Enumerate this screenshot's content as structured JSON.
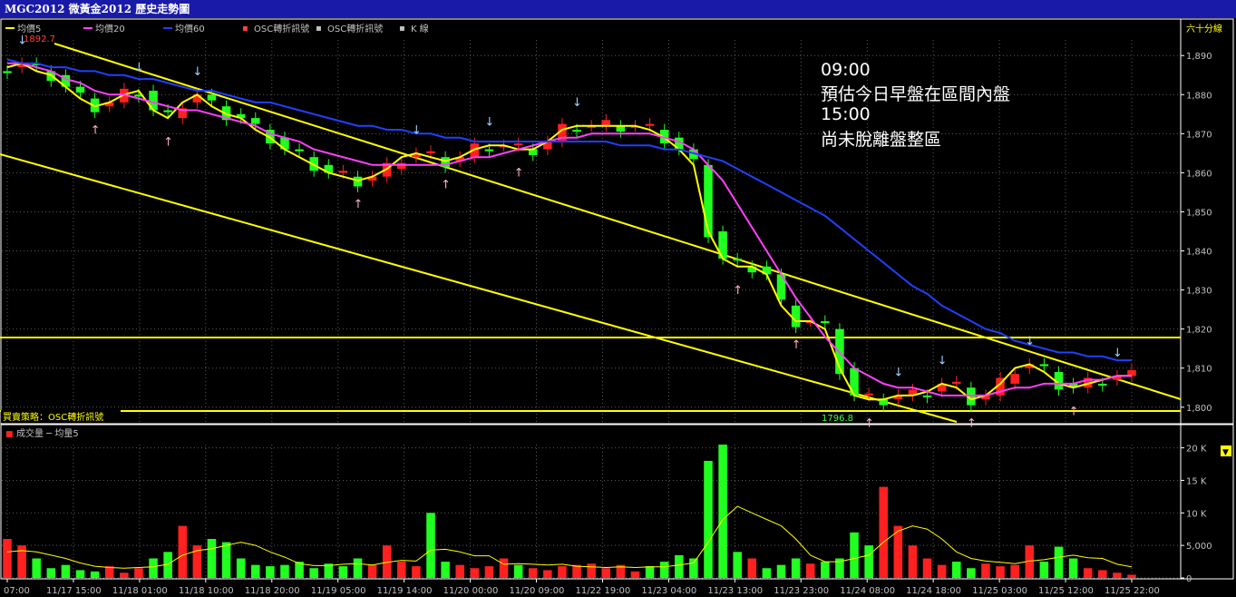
{
  "window": {
    "title": "MGC2012 微黃金2012  歷史走勢圖"
  },
  "price_panel": {
    "legend": [
      "均價5",
      "均價20",
      "均價60",
      "OSC轉折訊號",
      "OSC轉折訊號",
      "K 線"
    ],
    "legend_colors": [
      "#ffff00",
      "#ff40ff",
      "#2040ff",
      "#ff4040",
      "#c0c0c0",
      "#c0c0c0"
    ],
    "period": "六十分線",
    "strategy_label": "買賣策略：OSC轉折訊號",
    "high_label": "1892.7",
    "low_label": "1796.8",
    "annotation": [
      "09:00",
      "預估今日早盤在區間內盤",
      "15:00",
      "尚未脫離盤整區"
    ]
  },
  "volume_panel": {
    "legend": "成交量 ─ 均量5",
    "legend_color": "#ff2020"
  },
  "chart_data": [
    {
      "type": "candlestick",
      "y_ticks": [
        "1,890",
        "1,880",
        "1,870",
        "1,860",
        "1,850",
        "1,840",
        "1,830",
        "1,820",
        "1,810",
        "1,800"
      ],
      "ylim": [
        1796,
        1894
      ],
      "x_tick_labels": [
        "07:00",
        "11/17 15:00",
        "11/18 01:00",
        "11/18 10:00",
        "11/18 20:00",
        "11/19 05:00",
        "11/19 14:00",
        "11/20 00:00",
        "11/20 09:00",
        "11/22 19:00",
        "11/23 04:00",
        "11/23 13:00",
        "11/23 23:00",
        "11/24 08:00",
        "11/24 18:00",
        "11/25 03:00",
        "11/25 12:00",
        "11/25 22:00"
      ],
      "series": [
        {
          "name": "均價5",
          "color": "#ffff00",
          "values": [
            1887,
            1888,
            1886,
            1885,
            1882,
            1879,
            1877,
            1878,
            1880,
            1881,
            1876,
            1874,
            1878,
            1880,
            1877,
            1875,
            1874,
            1871,
            1869,
            1866,
            1864,
            1862,
            1860,
            1859,
            1858,
            1859,
            1861,
            1864,
            1865,
            1864,
            1863,
            1864,
            1866,
            1867,
            1867,
            1866,
            1866,
            1868,
            1871,
            1872,
            1872,
            1872,
            1872,
            1872,
            1871,
            1869,
            1866,
            1862,
            1845,
            1838,
            1836,
            1836,
            1834,
            1826,
            1822,
            1822,
            1820,
            1810,
            1803,
            1802,
            1802,
            1803,
            1803,
            1804,
            1806,
            1805,
            1802,
            1803,
            1806,
            1810,
            1811,
            1809,
            1806,
            1805,
            1806,
            1807,
            1808,
            1808
          ]
        },
        {
          "name": "均價20",
          "color": "#ff40ff",
          "values": [
            1888,
            1888,
            1887,
            1886,
            1884,
            1883,
            1881,
            1880,
            1880,
            1879,
            1878,
            1877,
            1876,
            1876,
            1875,
            1874,
            1873,
            1872,
            1870,
            1869,
            1868,
            1866,
            1865,
            1864,
            1863,
            1862,
            1862,
            1862,
            1862,
            1862,
            1862,
            1863,
            1864,
            1864,
            1865,
            1866,
            1867,
            1868,
            1869,
            1869,
            1870,
            1870,
            1870,
            1870,
            1870,
            1869,
            1868,
            1866,
            1862,
            1858,
            1852,
            1846,
            1840,
            1834,
            1828,
            1823,
            1818,
            1814,
            1810,
            1808,
            1806,
            1805,
            1805,
            1804,
            1803,
            1803,
            1803,
            1803,
            1804,
            1805,
            1805,
            1806,
            1806,
            1806,
            1807,
            1807,
            1808,
            1808
          ]
        },
        {
          "name": "均價60",
          "color": "#2040ff",
          "values": [
            1889,
            1888,
            1888,
            1887,
            1887,
            1886,
            1886,
            1885,
            1885,
            1884,
            1884,
            1883,
            1882,
            1881,
            1881,
            1880,
            1879,
            1878,
            1878,
            1877,
            1876,
            1875,
            1874,
            1873,
            1872,
            1872,
            1871,
            1871,
            1870,
            1870,
            1869,
            1869,
            1868,
            1868,
            1868,
            1868,
            1868,
            1868,
            1868,
            1868,
            1868,
            1868,
            1867,
            1867,
            1867,
            1866,
            1866,
            1865,
            1864,
            1863,
            1861,
            1859,
            1857,
            1855,
            1853,
            1851,
            1849,
            1846,
            1843,
            1840,
            1837,
            1834,
            1831,
            1829,
            1826,
            1824,
            1822,
            1820,
            1819,
            1817,
            1816,
            1815,
            1814,
            1814,
            1813,
            1813,
            1812,
            1812
          ]
        }
      ]
    },
    {
      "type": "bar",
      "y_ticks": [
        "20 K",
        "15 K",
        "10 K",
        "5,000",
        "0"
      ],
      "ylim": [
        0,
        20500
      ],
      "series": [
        {
          "name": "成交量",
          "values": [
            6000,
            5000,
            3000,
            1500,
            2000,
            1200,
            1000,
            1800,
            800,
            1500,
            3000,
            4000,
            8000,
            5000,
            6000,
            5500,
            3000,
            2000,
            1800,
            2000,
            2500,
            1500,
            2200,
            1800,
            3000,
            2000,
            5000,
            2500,
            1800,
            10000,
            2500,
            2000,
            1500,
            1800,
            3000,
            2000,
            1500,
            1200,
            1800,
            2000,
            2200,
            1500,
            2000,
            1000,
            1800,
            2500,
            3500,
            3000,
            18000,
            20500,
            4000,
            3000,
            1500,
            2000,
            3000,
            2200,
            2500,
            3000,
            7000,
            5000,
            14000,
            8000,
            5000,
            3000,
            2000,
            2500,
            1500,
            2200,
            1800,
            2000,
            5000,
            2500,
            4800,
            3000,
            1500,
            1200,
            800,
            500
          ]
        },
        {
          "name": "均量5",
          "values": [
            4000,
            4200,
            4000,
            3500,
            3000,
            2300,
            1800,
            1600,
            1500,
            1600,
            1700,
            2100,
            3500,
            4200,
            4500,
            5000,
            5500,
            5000,
            4000,
            3200,
            2200,
            1900,
            1900,
            2100,
            2200,
            2000,
            2400,
            2700,
            2600,
            4300,
            4400,
            4000,
            3400,
            3400,
            2100,
            2200,
            2100,
            2000,
            2100,
            1800,
            1700,
            1600,
            1700,
            1600,
            1700,
            1700,
            2000,
            2300,
            5500,
            9000,
            11000,
            10000,
            9000,
            8000,
            6000,
            3500,
            2500,
            2500,
            3000,
            3500,
            5500,
            7200,
            8000,
            7500,
            6000,
            4000,
            3000,
            2600,
            2400,
            2200,
            2600,
            2800,
            3200,
            3500,
            3100,
            3000,
            2100,
            1700
          ]
        }
      ]
    }
  ]
}
